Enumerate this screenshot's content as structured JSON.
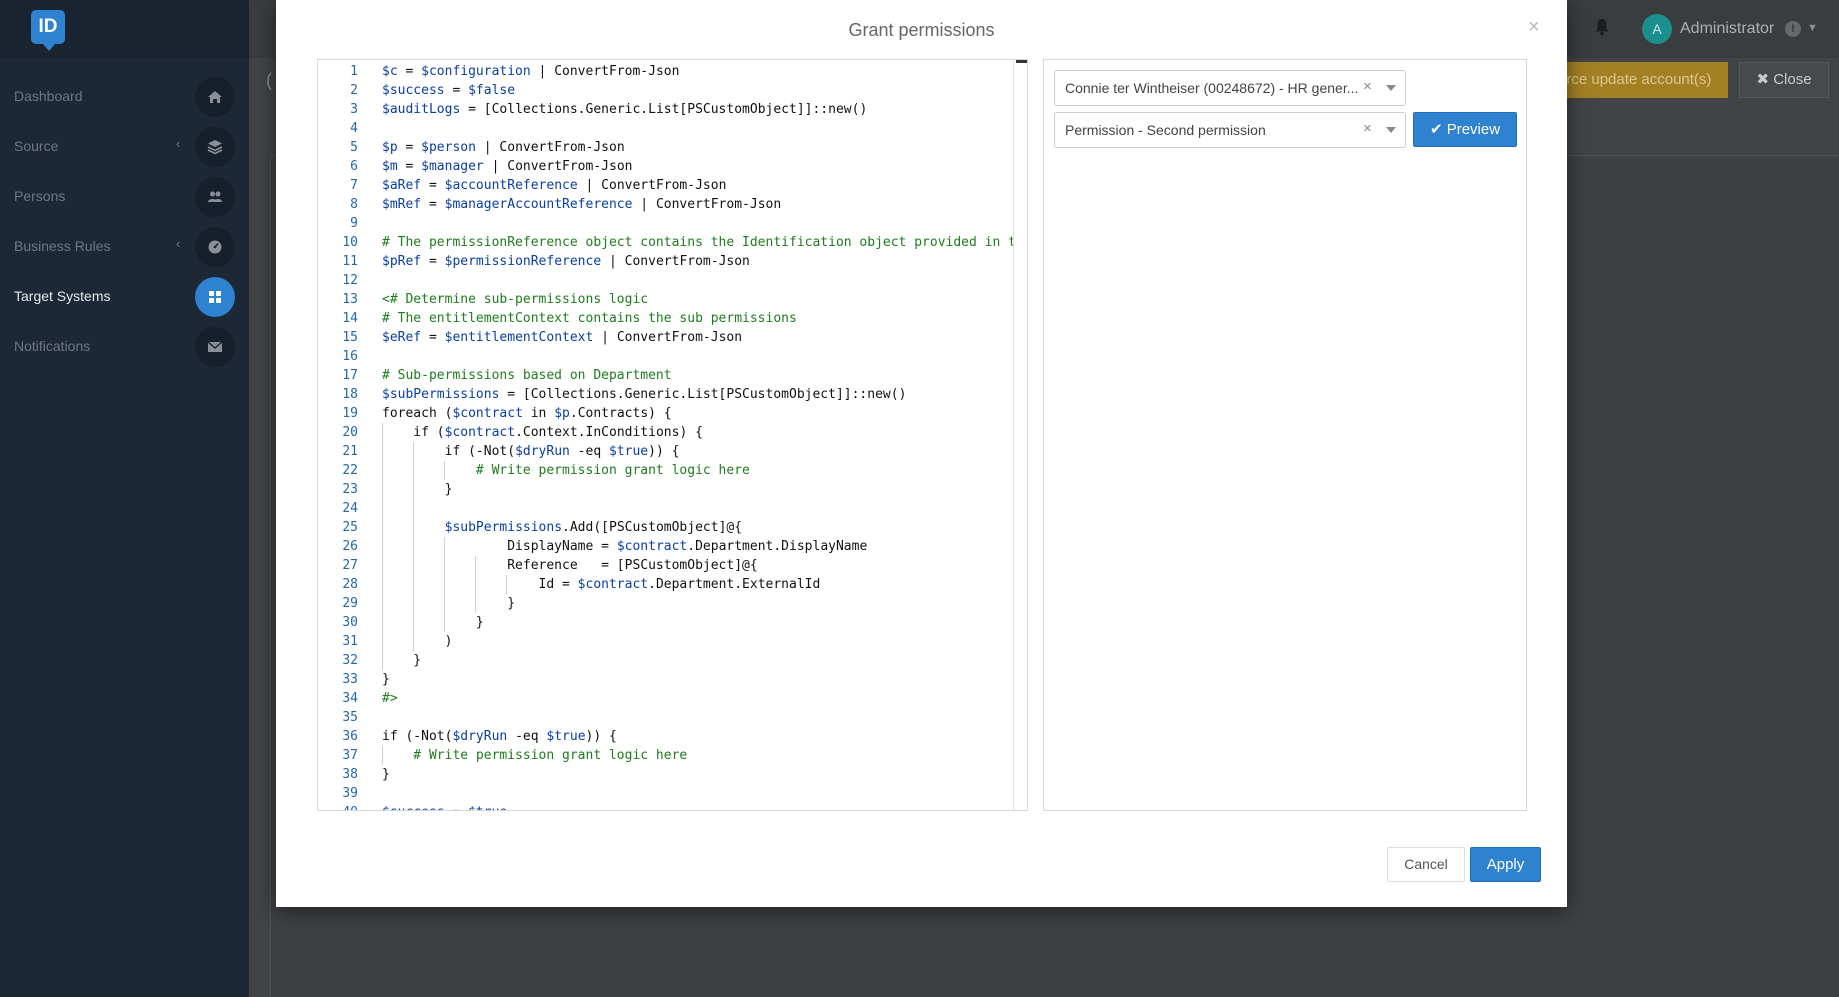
{
  "app": {
    "logo_text": "ID"
  },
  "sidebar": {
    "items": [
      {
        "label": "Dashboard",
        "icon": "home-icon",
        "chevron": false,
        "active": false
      },
      {
        "label": "Source",
        "icon": "layers-icon",
        "chevron": true,
        "active": false
      },
      {
        "label": "Persons",
        "icon": "users-icon",
        "chevron": false,
        "active": false
      },
      {
        "label": "Business Rules",
        "icon": "dashboard-icon",
        "chevron": true,
        "active": false
      },
      {
        "label": "Target Systems",
        "icon": "grid-icon",
        "chevron": false,
        "active": true
      },
      {
        "label": "Notifications",
        "icon": "envelope-icon",
        "chevron": false,
        "active": false
      }
    ]
  },
  "header": {
    "user_initial": "A",
    "user_name": "Administrator",
    "badge": "!"
  },
  "background": {
    "title_fragment": "(",
    "force_update_label": "orce update account(s)",
    "close_label": "✖ Close"
  },
  "modal": {
    "title": "Grant permissions",
    "close_symbol": "×",
    "code_lines": [
      "$c = $configuration | ConvertFrom-Json",
      "$success = $false",
      "$auditLogs = [Collections.Generic.List[PSCustomObject]]::new()",
      "",
      "$p = $person | ConvertFrom-Json",
      "$m = $manager | ConvertFrom-Json",
      "$aRef = $accountReference | ConvertFrom-Json",
      "$mRef = $managerAccountReference | ConvertFrom-Json",
      "",
      "# The permissionReference object contains the Identification object provided in the",
      "$pRef = $permissionReference | ConvertFrom-Json",
      "",
      "<# Determine sub-permissions logic",
      "# The entitlementContext contains the sub permissions",
      "$eRef = $entitlementContext | ConvertFrom-Json",
      "",
      "# Sub-permissions based on Department",
      "$subPermissions = [Collections.Generic.List[PSCustomObject]]::new()",
      "foreach ($contract in $p.Contracts) {",
      "    if ($contract.Context.InConditions) {",
      "        if (-Not($dryRun -eq $true)) {",
      "            # Write permission grant logic here",
      "        }",
      "",
      "        $subPermissions.Add([PSCustomObject]@{",
      "                DisplayName = $contract.Department.DisplayName",
      "                Reference   = [PSCustomObject]@{",
      "                    Id = $contract.Department.ExternalId",
      "                }",
      "            }",
      "        )",
      "    }",
      "}",
      "#>",
      "",
      "if (-Not($dryRun -eq $true)) {",
      "    # Write permission grant logic here",
      "}",
      "",
      "$success = $true"
    ],
    "person_select": "Connie ter Wintheiser (00248672) - HR gener...",
    "permission_select": "Permission - Second permission",
    "preview_label": "Preview",
    "cancel_label": "Cancel",
    "apply_label": "Apply"
  }
}
